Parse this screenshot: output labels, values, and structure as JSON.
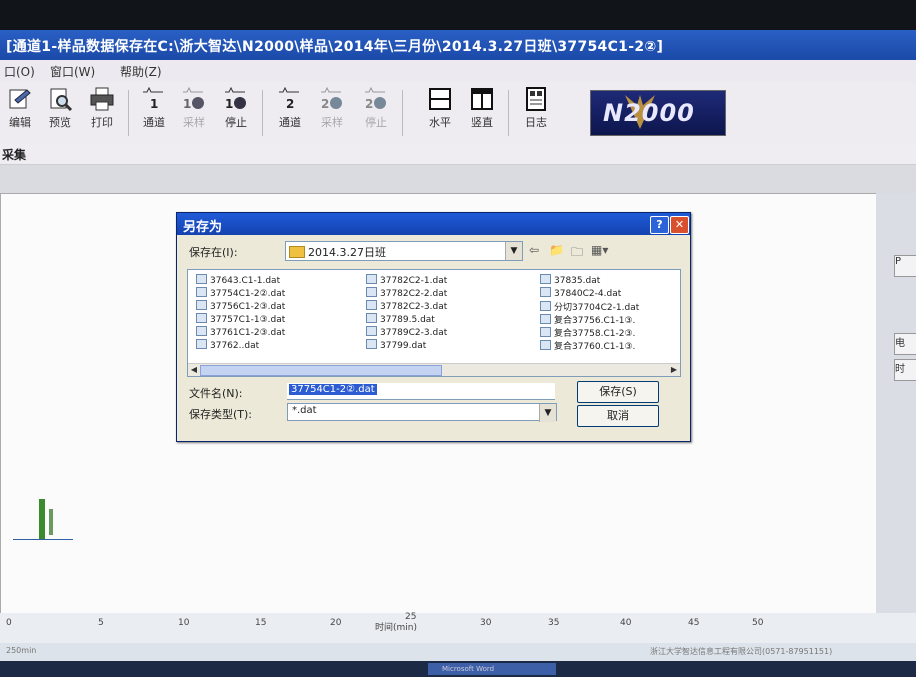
{
  "window": {
    "title": "[通道1-样品数据保存在C:\\浙大智达\\N2000\\样品\\2014年\\三月份\\2014.3.27日班\\37754C1-2②]"
  },
  "menu": [
    "口(O)",
    "窗口(W)",
    "帮助(Z)"
  ],
  "toolbar": {
    "buttons": [
      {
        "label": "编辑",
        "icon": "edit-icon",
        "enabled": true
      },
      {
        "label": "预览",
        "icon": "preview-icon",
        "enabled": true
      },
      {
        "label": "打印",
        "icon": "print-icon",
        "enabled": true
      },
      {
        "label": "通道",
        "icon": "channel1-icon",
        "enabled": true
      },
      {
        "label": "采样",
        "icon": "sample1-icon",
        "enabled": false
      },
      {
        "label": "停止",
        "icon": "stop1-icon",
        "enabled": true
      },
      {
        "label": "通道",
        "icon": "channel2-icon",
        "enabled": true
      },
      {
        "label": "采样",
        "icon": "sample2-icon",
        "enabled": false
      },
      {
        "label": "停止",
        "icon": "stop2-icon",
        "enabled": false
      },
      {
        "label": "水平",
        "icon": "horizontal-icon",
        "enabled": true
      },
      {
        "label": "竖直",
        "icon": "vertical-icon",
        "enabled": true
      },
      {
        "label": "日志",
        "icon": "log-icon",
        "enabled": true
      }
    ],
    "logo": "N2000"
  },
  "subtab": "采集",
  "dialog": {
    "title": "另存为",
    "save_in_label": "保存在(I):",
    "save_in_value": "2014.3.27日班",
    "files_col1": [
      "37643.C1-1.dat",
      "37754C1-2②.dat",
      "37756C1-2③.dat",
      "37757C1-1③.dat",
      "37761C1-2③.dat",
      "37762..dat"
    ],
    "files_col2": [
      "37782C2-1.dat",
      "37782C2-2.dat",
      "37782C2-3.dat",
      "37789.5.dat",
      "37789C2-3.dat",
      "37799.dat"
    ],
    "files_col3": [
      "37835.dat",
      "37840C2-4.dat",
      "分切37704C2-1.dat",
      "复合37756.C1-1③.",
      "复合37758.C1-2③.",
      "复合37760.C1-1③."
    ],
    "filename_label": "文件名(N):",
    "filename_value": "37754C1-2②.dat",
    "filetype_label": "保存类型(T):",
    "filetype_value": "*.dat",
    "save_button": "保存(S)",
    "cancel_button": "取消"
  },
  "xaxis": {
    "ticks": [
      "0",
      "5",
      "10",
      "15",
      "20",
      "25",
      "30",
      "35",
      "40",
      "45",
      "50"
    ],
    "label": "时间(min)"
  },
  "status": {
    "left": "250min",
    "right": "浙江大学智达信息工程有限公司(0571-87951151)"
  },
  "taskbar": {
    "item": "Microsoft Word"
  },
  "right_panel": [
    "P",
    "电",
    "时"
  ]
}
